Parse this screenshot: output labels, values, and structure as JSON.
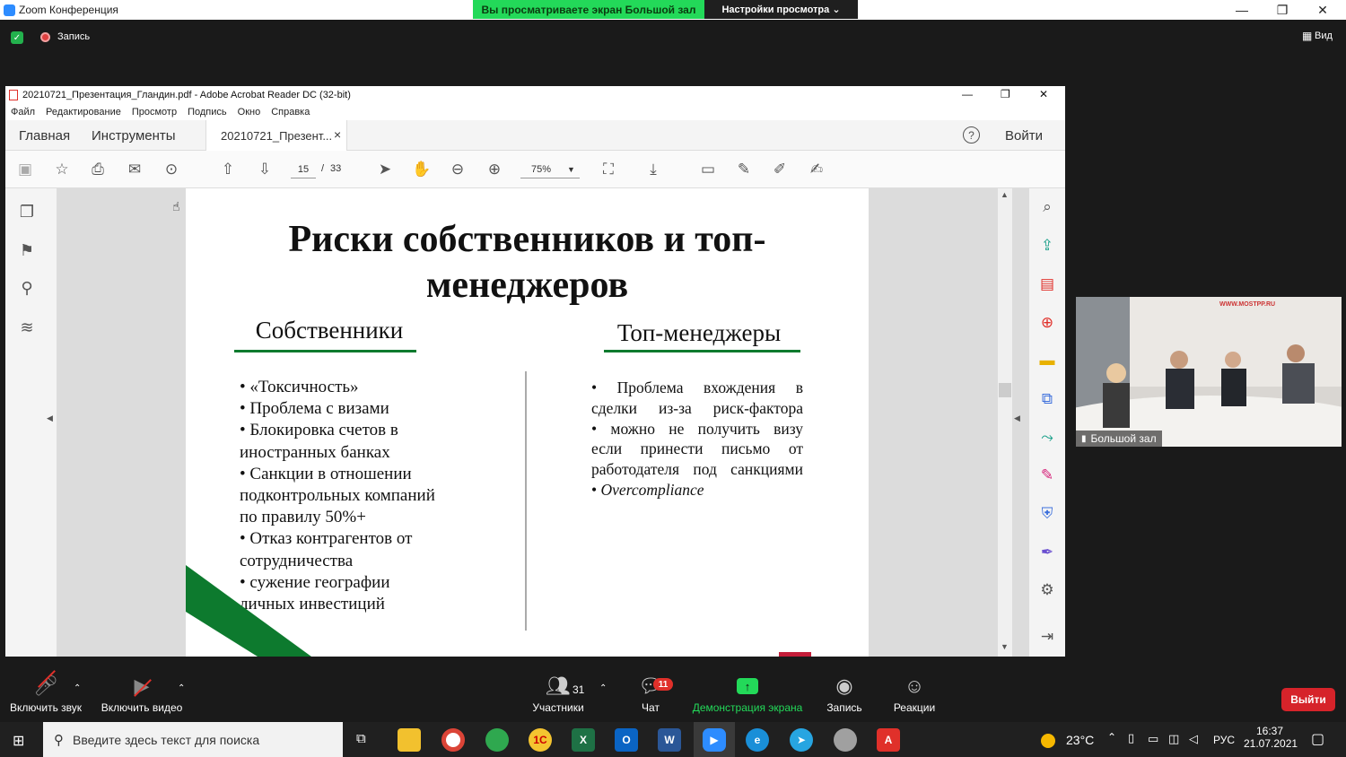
{
  "zoom": {
    "window_title": "Zoom Конференция",
    "viewing_banner": "Вы просматриваете экран Большой зал",
    "view_options": "Настройки просмотра ⌄",
    "recording": "Запись",
    "view_label": "Вид",
    "minimize": "—",
    "restore": "❐",
    "close": "✕"
  },
  "acrobat": {
    "title": "20210721_Презентация_Гландин.pdf - Adobe Acrobat Reader DC (32-bit)",
    "menu": [
      "Файл",
      "Редактирование",
      "Просмотр",
      "Подпись",
      "Окно",
      "Справка"
    ],
    "tab_home": "Главная",
    "tab_tools": "Инструменты",
    "tab_doc": "20210721_Презент...",
    "tab_close": "×",
    "signin": "Войти",
    "help": "?",
    "page_current": "15",
    "page_sep": "/",
    "page_total": "33",
    "zoom_level": "75%"
  },
  "slide": {
    "title_line1": "Риски собственников и топ-",
    "title_line2": "менеджеров",
    "col_left_heading": "Собственники",
    "col_right_heading": "Топ-менеджеры",
    "left_items": [
      "• «Токсичность»",
      "• Проблема с визами",
      "• Блокировка счетов в",
      "иностранных банках",
      "• Санкции в отношении",
      "подконтрольных компаний",
      "по правилу 50%+",
      "• Отказ контрагентов от",
      "сотрудничества",
      "• сужение географии",
      "личных инвестиций"
    ],
    "right_items": [
      "• Проблема вхождения в",
      "сделки из-за риск-фактора",
      "• можно не получить визу",
      "если принести письмо от",
      "работодателя под санкциями",
      "• Overcompliance"
    ]
  },
  "video": {
    "label": "Большой зал",
    "backdrop_text": "WWW.MOSTPP.RU"
  },
  "controls": {
    "mute": "Включить звук",
    "video": "Включить видео",
    "participants": "Участники",
    "participants_count": "31",
    "chat": "Чат",
    "chat_badge": "11",
    "share": "Демонстрация экрана",
    "record": "Запись",
    "reactions": "Реакции",
    "leave": "Выйти"
  },
  "taskbar": {
    "search_placeholder": "Введите здесь текст для поиска",
    "weather": "23°C",
    "lang": "РУС",
    "time": "16:37",
    "date": "21.07.2021"
  },
  "colors": {
    "zoom_green": "#23d959",
    "slide_green": "#0d7a2e",
    "leave_red": "#d6232a",
    "acrobat_red": "#e0302a"
  }
}
